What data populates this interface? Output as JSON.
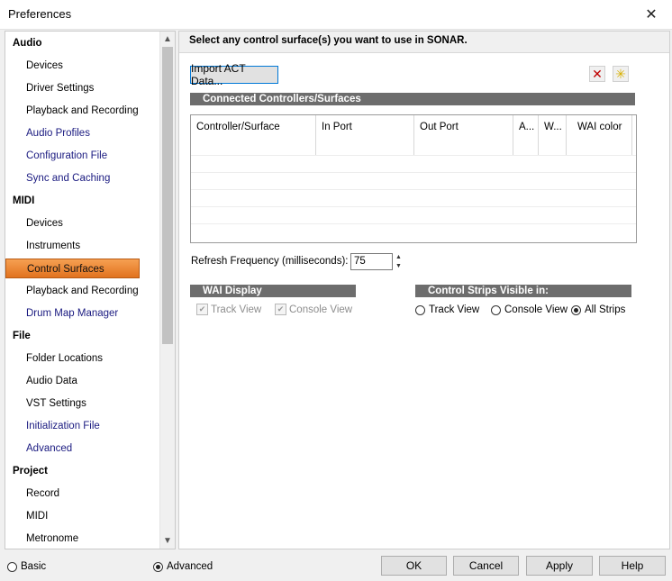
{
  "window": {
    "title": "Preferences",
    "close_glyph": "✕"
  },
  "tree": {
    "items": [
      {
        "label": "Audio",
        "kind": "cat"
      },
      {
        "label": "Devices",
        "kind": "leaf"
      },
      {
        "label": "Driver Settings",
        "kind": "leaf"
      },
      {
        "label": "Playback and Recording",
        "kind": "leaf"
      },
      {
        "label": "Audio Profiles",
        "kind": "alt"
      },
      {
        "label": "Configuration File",
        "kind": "alt"
      },
      {
        "label": "Sync and Caching",
        "kind": "alt"
      },
      {
        "label": "MIDI",
        "kind": "cat"
      },
      {
        "label": "Devices",
        "kind": "leaf"
      },
      {
        "label": "Instruments",
        "kind": "leaf"
      },
      {
        "label": "Control Surfaces",
        "kind": "sel"
      },
      {
        "label": "Playback and Recording",
        "kind": "leaf"
      },
      {
        "label": "Drum Map Manager",
        "kind": "alt"
      },
      {
        "label": "File",
        "kind": "cat"
      },
      {
        "label": "Folder Locations",
        "kind": "leaf"
      },
      {
        "label": "Audio Data",
        "kind": "leaf"
      },
      {
        "label": "VST Settings",
        "kind": "leaf"
      },
      {
        "label": "Initialization File",
        "kind": "alt"
      },
      {
        "label": "Advanced",
        "kind": "alt"
      },
      {
        "label": "Project",
        "kind": "cat"
      },
      {
        "label": "Record",
        "kind": "leaf"
      },
      {
        "label": "MIDI",
        "kind": "leaf"
      },
      {
        "label": "Metronome",
        "kind": "leaf"
      }
    ]
  },
  "panel": {
    "header": "Select any control surface(s) you want to use in SONAR.",
    "import_button": "Import ACT Data...",
    "delete_icon": "✕",
    "add_icon": "✳",
    "connected_title": "Connected Controllers/Surfaces",
    "grid_columns": [
      "Controller/Surface",
      "In Port",
      "Out Port",
      "A...",
      "W...",
      "WAI color"
    ],
    "refresh_label": "Refresh Frequency (milliseconds):",
    "refresh_value": "75",
    "wai_title": "WAI Display",
    "wai_track": "Track View",
    "wai_console": "Console View",
    "strips_title": "Control Strips Visible in:",
    "strips_track": "Track View",
    "strips_console": "Console View",
    "strips_all": "All Strips",
    "strips_selected": "All Strips"
  },
  "bottom": {
    "mode_basic": "Basic",
    "mode_advanced": "Advanced",
    "mode_selected": "Advanced",
    "ok": "OK",
    "cancel": "Cancel",
    "apply": "Apply",
    "help": "Help"
  }
}
